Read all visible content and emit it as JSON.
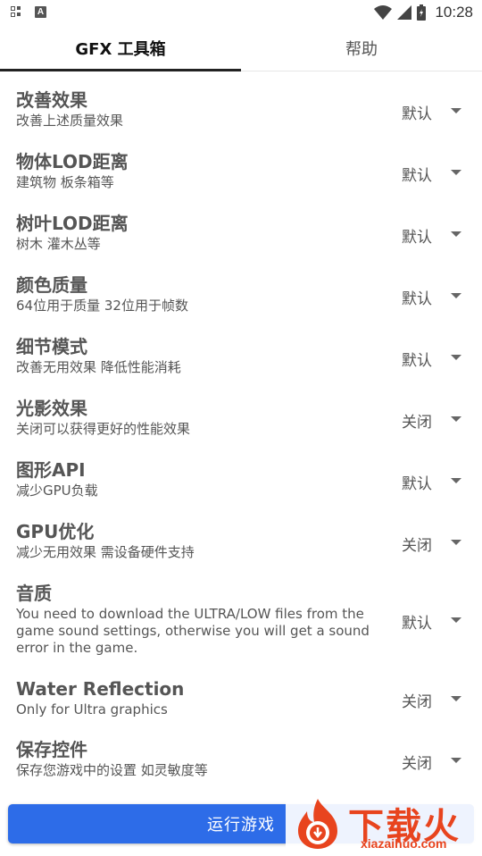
{
  "status_bar": {
    "time": "10:28"
  },
  "tabs": [
    {
      "label": "GFX 工具箱",
      "active": true
    },
    {
      "label": "帮助",
      "active": false
    }
  ],
  "settings": [
    {
      "title": "改善效果",
      "subtitle": "改善上述质量效果",
      "value": "默认"
    },
    {
      "title": "物体LOD距离",
      "subtitle": "建筑物 板条箱等",
      "value": "默认"
    },
    {
      "title": "树叶LOD距离",
      "subtitle": "树木 灌木丛等",
      "value": "默认"
    },
    {
      "title": "颜色质量",
      "subtitle": "64位用于质量 32位用于帧数",
      "value": "默认"
    },
    {
      "title": "细节模式",
      "subtitle": "改善无用效果 降低性能消耗",
      "value": "默认"
    },
    {
      "title": "光影效果",
      "subtitle": "关闭可以获得更好的性能效果",
      "value": "关闭"
    },
    {
      "title": "图形API",
      "subtitle": "减少GPU负载",
      "value": "默认"
    },
    {
      "title": "GPU优化",
      "subtitle": "减少无用效果 需设备硬件支持",
      "value": "关闭"
    },
    {
      "title": "音质",
      "subtitle": "You need to download the ULTRA/LOW files from the game sound settings, otherwise you will get a sound error in the game.",
      "value": "默认"
    },
    {
      "title": "Water Reflection",
      "subtitle": "Only for Ultra graphics",
      "value": "关闭"
    },
    {
      "title": "保存控件",
      "subtitle": "保存您游戏中的设置 如灵敏度等",
      "value": "关闭"
    }
  ],
  "run_button": {
    "label": "运行游戏"
  },
  "watermark": {
    "brand": "下载火",
    "url": "xiazaihuo.com"
  },
  "colors": {
    "accent": "#2d6ce8",
    "watermark": "#e8441e"
  },
  "icons": [
    "grid-notification-icon",
    "a-notification-icon",
    "wifi-icon",
    "signal-icon",
    "battery-icon",
    "dropdown-caret-icon"
  ]
}
